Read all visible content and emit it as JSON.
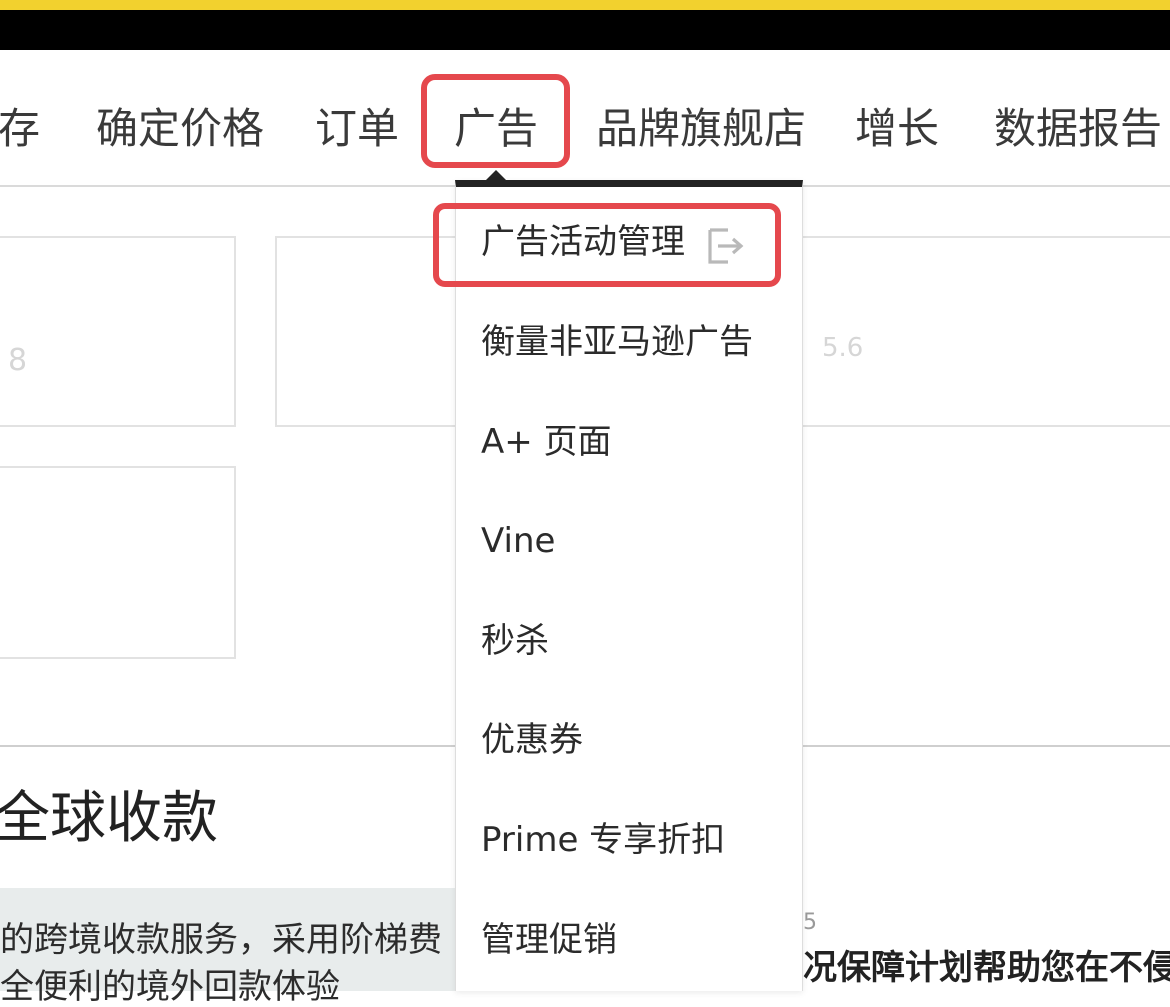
{
  "nav": {
    "items": [
      "存",
      "确定价格",
      "订单",
      "广告",
      "品牌旗舰店",
      "增长",
      "数据报告"
    ]
  },
  "dropdown": {
    "items": [
      "广告活动管理",
      "衡量非亚马逊广告",
      "A+ 页面",
      "Vine",
      "秒杀",
      "优惠券",
      "Prime 专享折扣",
      "管理促销"
    ],
    "external_icon": "external-link-icon"
  },
  "background": {
    "card_left_value": "8",
    "card_mid_value": "5.6",
    "section_title": "全球收款",
    "info_line_1": "的跨境收款服务，采用阶梯费",
    "info_line_2": "全便利的境外回款体验",
    "right_small": "5",
    "right_bold": "况保障计划帮助您在不侵"
  },
  "colors": {
    "highlight": "#e5484d",
    "top_strip": "#f2d12e",
    "dropdown_border": "#232323"
  }
}
